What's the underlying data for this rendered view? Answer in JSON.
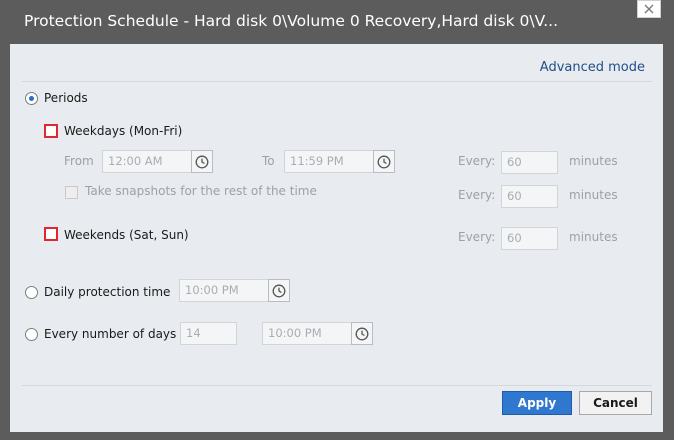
{
  "window": {
    "title": "Protection Schedule - Hard disk 0\\Volume 0 Recovery,Hard disk 0\\V...",
    "close_icon": "close-icon"
  },
  "advanced_mode_label": "Advanced mode",
  "periods": {
    "label": "Periods",
    "selected": true,
    "weekdays": {
      "label": "Weekdays (Mon-Fri)",
      "from_label": "From",
      "from_value": "12:00 AM",
      "to_label": "To",
      "to_value": "11:59 PM",
      "every_label": "Every:",
      "every_value": "60",
      "unit": "minutes",
      "snapshots_label": "Take snapshots for the rest of the time",
      "snapshots_every_label": "Every:",
      "snapshots_every_value": "60",
      "snapshots_unit": "minutes"
    },
    "weekends": {
      "label": "Weekends (Sat, Sun)",
      "every_label": "Every:",
      "every_value": "60",
      "unit": "minutes"
    }
  },
  "daily": {
    "label": "Daily protection time",
    "time_value": "10:00 PM"
  },
  "every_days": {
    "label": "Every number of days",
    "days_value": "14",
    "time_value": "10:00 PM"
  },
  "buttons": {
    "apply": "Apply",
    "cancel": "Cancel"
  },
  "colors": {
    "accent": "#2f77cf",
    "checkbox_highlight": "#e0262e",
    "link": "#1f4e87"
  }
}
